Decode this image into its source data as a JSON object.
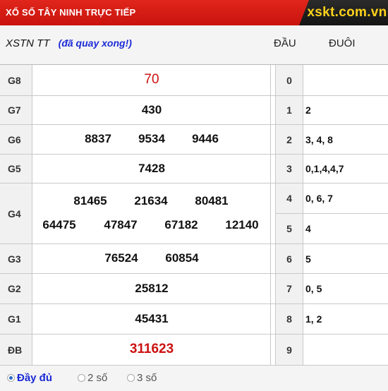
{
  "header": {
    "title": "XỔ SỐ TÂY NINH TRỰC TIẾP",
    "logo": "xskt.com.vn"
  },
  "subheader": {
    "code": "XSTN TT",
    "status_note": "(đã quay xong!)",
    "col_dau": "ĐẦU",
    "col_duoi": "ĐUÔI"
  },
  "prizes": {
    "g8": {
      "label": "G8",
      "numbers": [
        "70"
      ]
    },
    "g7": {
      "label": "G7",
      "numbers": [
        "430"
      ]
    },
    "g6": {
      "label": "G6",
      "numbers": [
        "8837",
        "9534",
        "9446"
      ]
    },
    "g5": {
      "label": "G5",
      "numbers": [
        "7428"
      ]
    },
    "g4": {
      "label": "G4",
      "numbers": [
        "81465",
        "21634",
        "80481",
        "64475",
        "47847",
        "67182",
        "12140"
      ]
    },
    "g3": {
      "label": "G3",
      "numbers": [
        "76524",
        "60854"
      ]
    },
    "g2": {
      "label": "G2",
      "numbers": [
        "25812"
      ]
    },
    "g1": {
      "label": "G1",
      "numbers": [
        "45431"
      ]
    },
    "db": {
      "label": "ĐB",
      "numbers": [
        "311623"
      ]
    }
  },
  "loto": [
    {
      "dau": "0",
      "duoi": ""
    },
    {
      "dau": "1",
      "duoi": "2"
    },
    {
      "dau": "2",
      "duoi": "3, 4, 8"
    },
    {
      "dau": "3",
      "duoi": "0,1,4,4,7"
    },
    {
      "dau": "4",
      "duoi": "0, 6, 7"
    },
    {
      "dau": "5",
      "duoi": "4"
    },
    {
      "dau": "6",
      "duoi": "5"
    },
    {
      "dau": "7",
      "duoi": "0, 5"
    },
    {
      "dau": "8",
      "duoi": "1, 2"
    },
    {
      "dau": "9",
      "duoi": ""
    }
  ],
  "footer": {
    "options": [
      "Đầy đủ",
      "2 số",
      "3 số"
    ],
    "selected": "Đầy đủ"
  },
  "colors": {
    "header_red": "#d41c14",
    "logo_yellow": "#ffd21a",
    "highlight_red": "#cc1111",
    "note_blue": "#1a2ad6"
  }
}
